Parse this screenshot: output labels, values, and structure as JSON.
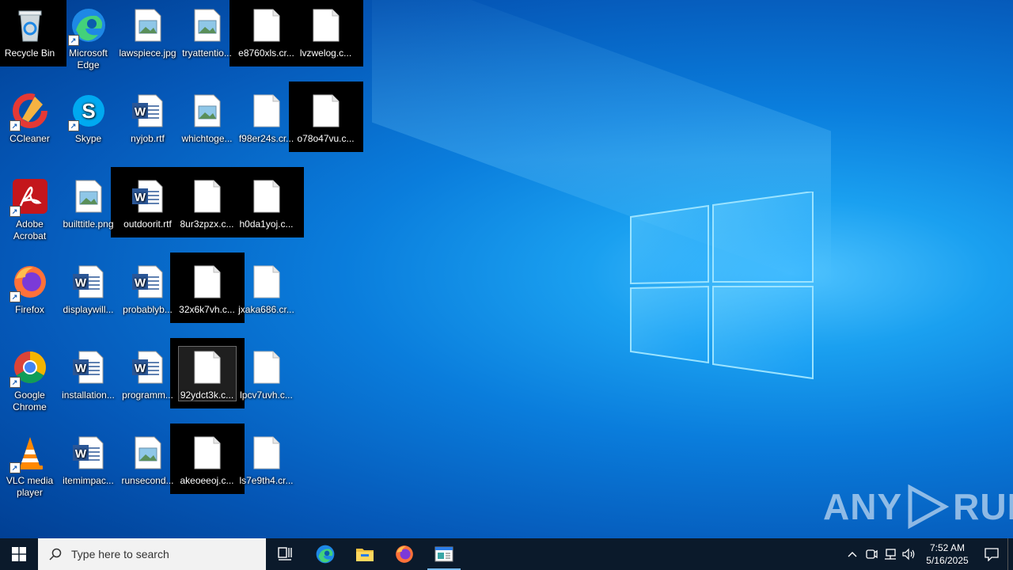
{
  "desktop": {
    "icons": [
      {
        "label": "Recycle Bin"
      },
      {
        "label": "Microsoft Edge"
      },
      {
        "label": "lawspiece.jpg"
      },
      {
        "label": "tryattentio..."
      },
      {
        "label": "e8760xls.cr..."
      },
      {
        "label": "lvzwelog.c..."
      },
      {
        "label": "CCleaner"
      },
      {
        "label": "Skype"
      },
      {
        "label": "nyjob.rtf"
      },
      {
        "label": "whichtoge..."
      },
      {
        "label": "f98er24s.cr..."
      },
      {
        "label": "o78o47vu.c..."
      },
      {
        "label": "Adobe Acrobat"
      },
      {
        "label": "builttitle.png"
      },
      {
        "label": "outdoorit.rtf"
      },
      {
        "label": "8ur3zpzx.c..."
      },
      {
        "label": "h0da1yoj.c..."
      },
      {
        "label": "Firefox"
      },
      {
        "label": "displaywill..."
      },
      {
        "label": "probablyb..."
      },
      {
        "label": "32x6k7vh.c..."
      },
      {
        "label": "jxaka686.cr..."
      },
      {
        "label": "Google Chrome"
      },
      {
        "label": "installation..."
      },
      {
        "label": "programm..."
      },
      {
        "label": "92ydct3k.c..."
      },
      {
        "label": "lpcv7uvh.c..."
      },
      {
        "label": "VLC media player"
      },
      {
        "label": "itemimpac..."
      },
      {
        "label": "runsecond..."
      },
      {
        "label": "akeoeeoj.c..."
      },
      {
        "label": "ls7e9th4.cr..."
      }
    ]
  },
  "taskbar": {
    "search_placeholder": "Type here to search",
    "clock_time": "7:52 AM",
    "clock_date": "5/16/2025",
    "pinned": [
      "task-view-icon",
      "edge-icon",
      "file-explorer-icon",
      "firefox-icon",
      "active-window-icon"
    ]
  },
  "watermark": {
    "text_left": "ANY",
    "text_right": "RUN"
  },
  "colors": {
    "accent": "#0078d7",
    "taskbar": "#0b1a2b"
  }
}
